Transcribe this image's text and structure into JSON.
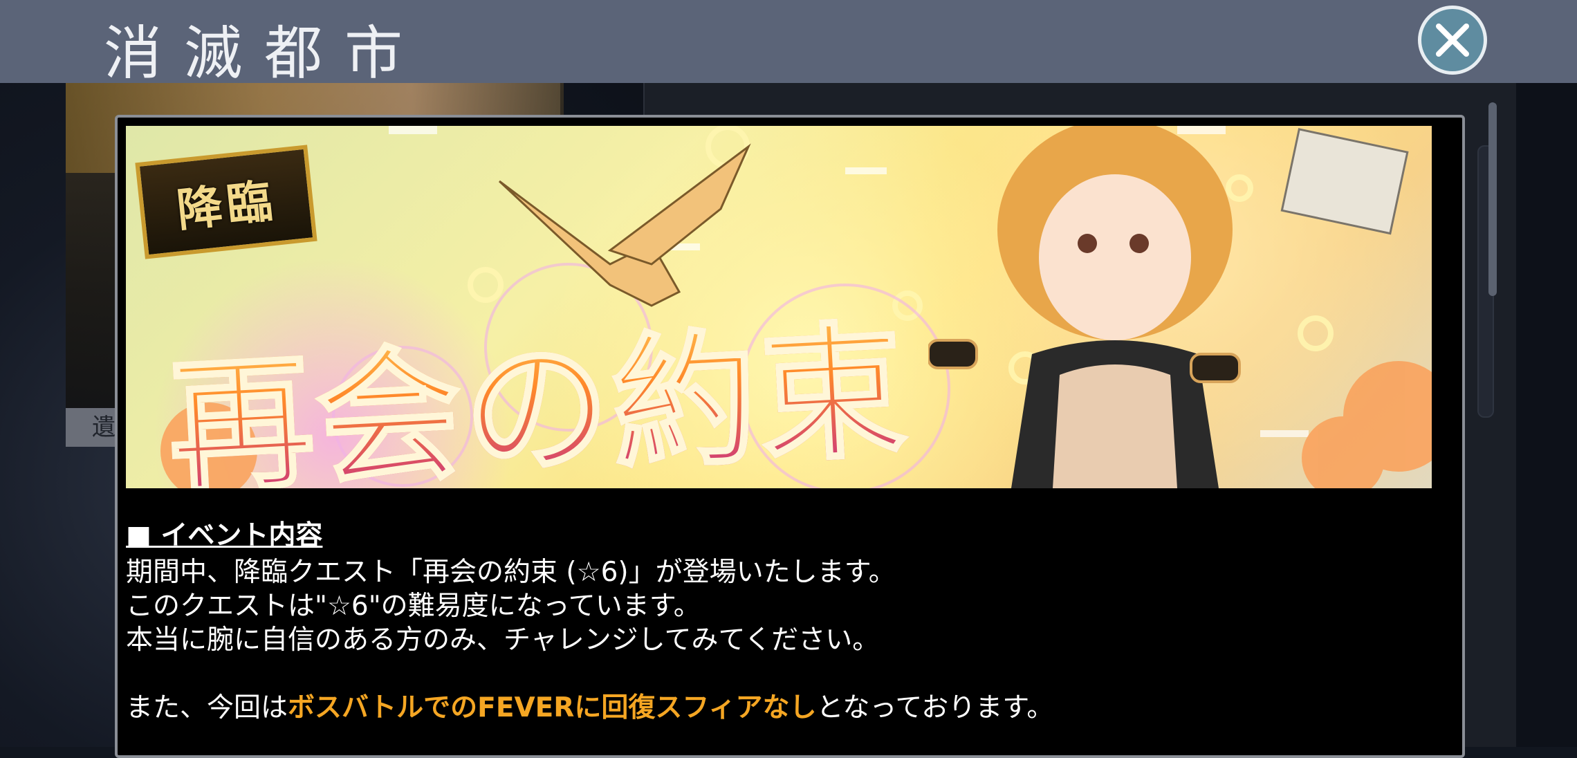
{
  "header": {
    "title": "消滅都市"
  },
  "background": {
    "side_button_label": "遺"
  },
  "banner": {
    "badge": "降臨",
    "title": "再会の約束"
  },
  "content": {
    "heading": "■ イベント内容",
    "line1": "期間中、降臨クエスト「再会の約束 (☆6)」が登場いたします。",
    "line2": "このクエストは\"☆6\"の難易度になっています。",
    "line3": "本当に腕に自信のある方のみ、チャレンジしてみてください。",
    "line4_prefix": "また、今回は",
    "line4_highlight": "ボスバトルでのFEVERに回復スフィアなし",
    "line4_suffix": "となっております。"
  },
  "colors": {
    "title_bar": "#5b6478",
    "close_button": "#5f8ca0",
    "highlight": "#f5a623"
  },
  "icons": {
    "close": "close-icon"
  }
}
